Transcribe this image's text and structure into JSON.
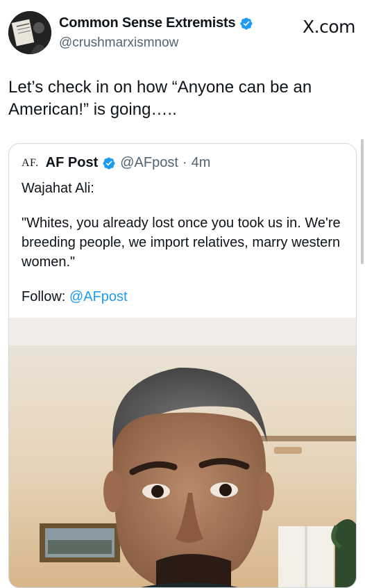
{
  "author": {
    "display_name": "Common Sense Extremists",
    "handle": "@crushmarxismnow",
    "verified": true
  },
  "brand": {
    "label": "X.com"
  },
  "tweet": {
    "text": "Let’s check in on how “Anyone can be an American!” is going….."
  },
  "quoted_post": {
    "logo_text": "AF.",
    "display_name": "AF Post",
    "handle": "@AFpost",
    "separator": "·",
    "time": "4m",
    "speaker": "Wajahat Ali:",
    "quote": "\"Whites, you already lost once you took us in. We're breeding people, we import relatives, marry western women.\"",
    "follow_label": "Follow:",
    "follow_handle": "@AFpost"
  },
  "colors": {
    "text": "#0f1419",
    "secondary": "#536471",
    "link": "#1d9bf0",
    "verified": "#1d9bf0",
    "border": "#cfd9de"
  },
  "icons": {
    "verified": "verified-badge-icon"
  }
}
